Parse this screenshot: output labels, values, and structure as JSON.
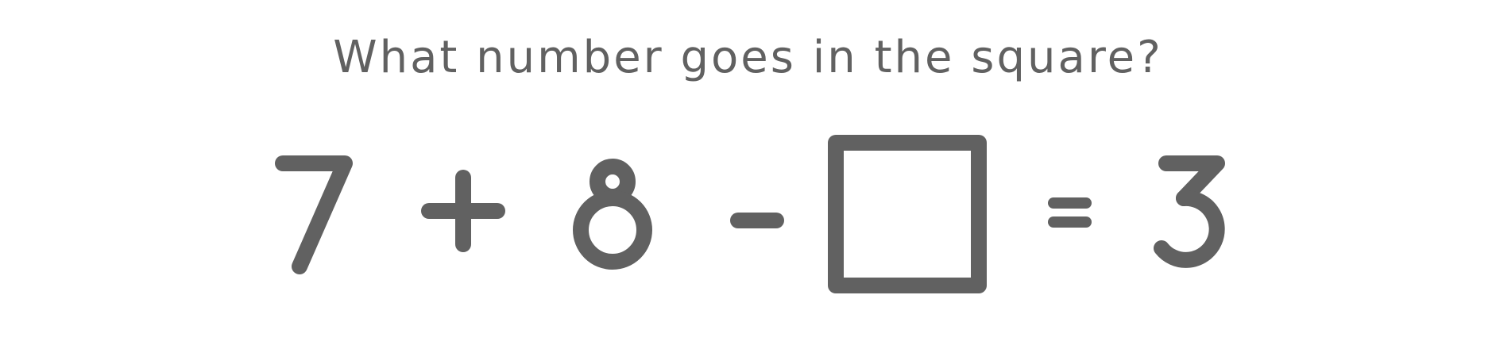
{
  "question": {
    "text": "What number goes in the square?"
  },
  "equation": {
    "first_operand": "7",
    "operator_1": "+",
    "second_operand": "8",
    "operator_2": "-",
    "blank_label": "empty-answer-square",
    "equals": "=",
    "result": "3"
  },
  "colors": {
    "ink": "#616161",
    "background": "#ffffff"
  }
}
